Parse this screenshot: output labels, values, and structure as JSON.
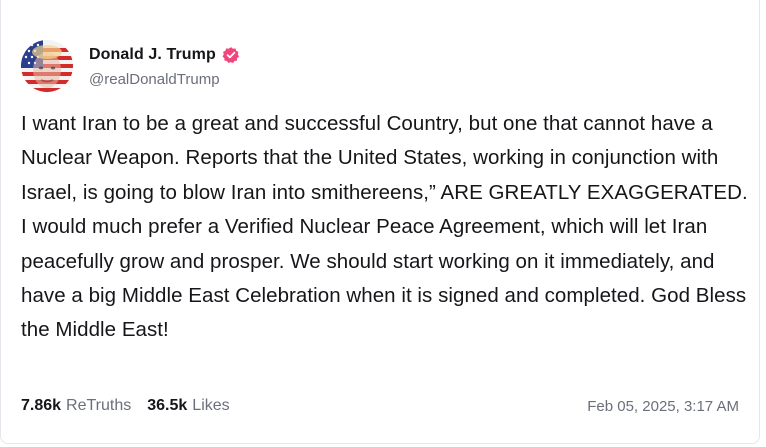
{
  "post": {
    "author": {
      "display_name": "Donald J. Trump",
      "handle": "@realDonaldTrump",
      "verified": true,
      "verified_badge_color": "#f1457c",
      "avatar_icon": "profile-photo-with-american-flag-overlay"
    },
    "text": "I want Iran to be a great and successful Country, but one that cannot have a Nuclear Weapon. Reports that the United States, working in conjunction with Israel, is going to blow Iran into smithereens,” ARE GREATLY EXAGGERATED. I would much prefer a Verified Nuclear Peace Agreement, which will let Iran peacefully grow and prosper. We should start working on it immediately, and have a big Middle East Celebration when it is signed and completed. God Bless the Middle East!",
    "stats": {
      "retruths_count": "7.86k",
      "retruths_label": "ReTruths",
      "likes_count": "36.5k",
      "likes_label": "Likes"
    },
    "timestamp": "Feb 05, 2025, 3:17 AM"
  }
}
